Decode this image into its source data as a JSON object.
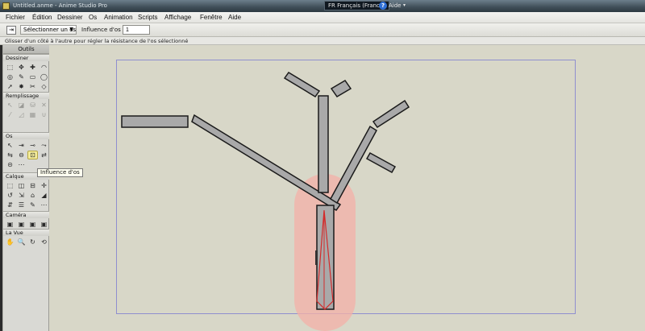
{
  "window": {
    "title": "Untitled.anme - Anime Studio Pro",
    "language": "FR Français (France)",
    "help": "Aide",
    "help_glyph": "?"
  },
  "menu": [
    "Fichier",
    "Édition",
    "Dessiner",
    "Os",
    "Animation",
    "Scripts",
    "Affichage",
    "Fenêtre",
    "Aide"
  ],
  "options": {
    "mode_select": "Sélectionner un os",
    "influence_label": "Influence d'os :",
    "influence_value": "1"
  },
  "status": "Glisser d'un côté à l'autre pour régler la résistance de l'os sélectionné",
  "tools": {
    "title": "Outils",
    "sections": [
      {
        "label": "Dessiner",
        "icons": [
          "select-points-icon",
          "transform-points-icon",
          "add-point-icon",
          "curvature-icon",
          "magnet-icon",
          "freehand-icon",
          "rectangle-icon",
          "oval-icon",
          "arrow-icon",
          "scatter-brush-icon",
          "delete-edge-icon",
          "perspective-icon",
          "shear-icon",
          "bend-icon",
          "noise-icon",
          "rotate-points-icon"
        ],
        "glyphs": [
          "⬚",
          "✥",
          "✚",
          "◠",
          "◎",
          "✎",
          "▭",
          "◯",
          "➚",
          "✸",
          "✂",
          "◇",
          "▱",
          "⌒",
          "∿",
          "↻"
        ]
      },
      {
        "label": "Remplissage",
        "icons": [
          "select-shape-icon",
          "create-shape-icon",
          "paint-bucket-icon",
          "delete-shape-icon",
          "line-width-icon",
          "hide-edge-icon",
          "stroke-exposure-icon",
          "curve-profile-icon"
        ],
        "glyphs": [
          "↖",
          "◪",
          "⛁",
          "✕",
          "⁄",
          "◿",
          "▦",
          "∪"
        ]
      },
      {
        "label": "Os",
        "icons": [
          "select-bone-icon",
          "translate-bone-icon",
          "add-bone-icon",
          "reparent-bone-icon",
          "bone-strength-icon",
          "manipulate-bones-icon",
          "bind-layer-icon",
          "bind-points-icon",
          "offset-bone-icon",
          "transform-bone-icon"
        ],
        "glyphs": [
          "↖",
          "⇥",
          "⊸",
          "⤳",
          "⇆",
          "⊖",
          "⊡",
          "⇄",
          "⊝",
          "⋯"
        ],
        "active_index": 6
      },
      {
        "label": "Calque",
        "icons": [
          "transform-layer-icon",
          "set-origin-icon",
          "bone-layer-icon",
          "translate-layer-icon",
          "rotate-layer-icon",
          "scale-layer-icon",
          "shear-layer-icon",
          "flip-h-icon",
          "flip-v-icon",
          "layer-selector-icon",
          "eyedropper-icon",
          "other-icon"
        ],
        "glyphs": [
          "⬚",
          "◫",
          "⊟",
          "✛",
          "↺",
          "⇲",
          "⌂",
          "◢",
          "⇵",
          "☰",
          "✎",
          "⋯"
        ]
      },
      {
        "label": "Caméra",
        "icons": [
          "track-camera-icon",
          "zoom-camera-icon",
          "roll-camera-icon",
          "pan-tilt-camera-icon"
        ],
        "glyphs": [
          "▣",
          "▣",
          "▣",
          "▣"
        ]
      },
      {
        "label": "La Vue",
        "icons": [
          "hand-pan-icon",
          "zoom-view-icon",
          "rotate-view-icon",
          "orbit-view-icon"
        ],
        "glyphs": [
          "✋",
          "🔍",
          "↻",
          "⟲"
        ]
      }
    ],
    "tooltip": "Influence d'os"
  },
  "colors": {
    "canvas_bg": "#d8d7c8",
    "frame": "#8f8fcf",
    "bone_fill": "#a9a9a9",
    "bone_stroke": "#1a1a1a",
    "influence": "#f4b0a8",
    "selected_bone": "#d42a2a"
  }
}
